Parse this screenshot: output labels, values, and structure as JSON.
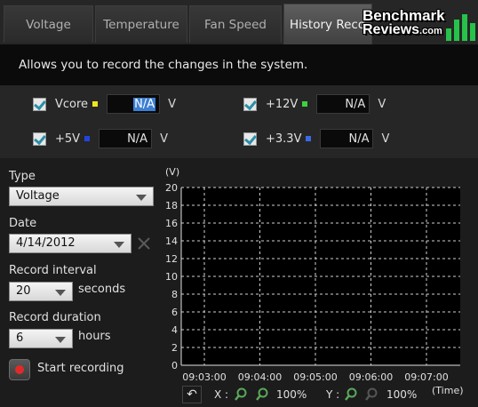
{
  "tabs": [
    {
      "label": "Voltage",
      "active": false
    },
    {
      "label": "Temperature",
      "active": false
    },
    {
      "label": "Fan Speed",
      "active": false
    },
    {
      "label": "History Reco",
      "active": true
    }
  ],
  "logo": {
    "line1": "Benchmark",
    "line2": "Reviews",
    "line2_suffix": ".com"
  },
  "description": "Allows you to record the changes in the system.",
  "voltages": [
    {
      "label": "Vcore",
      "value": "N/A",
      "unit": "V",
      "checked": true,
      "color": "#f2e31c",
      "selected": true
    },
    {
      "label": "+12V",
      "value": "N/A",
      "unit": "V",
      "checked": true,
      "color": "#3fd03f",
      "selected": false
    },
    {
      "label": "+5V",
      "value": "N/A",
      "unit": "V",
      "checked": true,
      "color": "#2244dd",
      "selected": false
    },
    {
      "label": "+3.3V",
      "value": "N/A",
      "unit": "V",
      "checked": true,
      "color": "#3a6ae8",
      "selected": false
    }
  ],
  "form": {
    "type_label": "Type",
    "type_value": "Voltage",
    "date_label": "Date",
    "date_value": "4/14/2012",
    "interval_label": "Record interval",
    "interval_value": "20",
    "interval_unit": "seconds",
    "duration_label": "Record duration",
    "duration_value": "6",
    "duration_unit": "hours",
    "start_label": "Start recording"
  },
  "chart_data": {
    "type": "line",
    "ylabel": "(V)",
    "xlabel": "(Time)",
    "ylim": [
      0,
      20
    ],
    "yticks": [
      0,
      2,
      4,
      6,
      8,
      10,
      12,
      14,
      16,
      18,
      20
    ],
    "x_ticks": [
      "09:03:00",
      "09:04:00",
      "09:05:00",
      "09:06:00",
      "09:07:00"
    ],
    "series": [],
    "grid": true
  },
  "zoom": {
    "x_label": "X :",
    "x_value": "100%",
    "y_label": "Y :",
    "y_value": "100%"
  }
}
